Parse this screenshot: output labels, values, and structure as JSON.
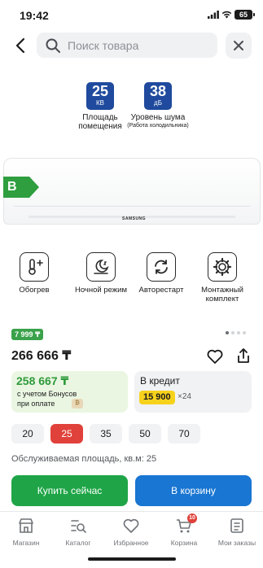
{
  "status_bar": {
    "time": "19:42",
    "battery": "65"
  },
  "search": {
    "placeholder": "Поиск товара"
  },
  "specs": [
    {
      "value": "25",
      "unit": "КВ",
      "label": "Площадь помещения",
      "sub": ""
    },
    {
      "value": "38",
      "unit": "дБ",
      "label": "Уровень шума",
      "sub": "(Работа холодильника)"
    }
  ],
  "product": {
    "brand_logo": "SAMSUNG",
    "energy_class": "B",
    "energy_color": "#2e9e3e"
  },
  "features": [
    {
      "label": "Обогрев",
      "icon": "thermometer-plus-icon"
    },
    {
      "label": "Ночной режим",
      "icon": "night-mode-icon"
    },
    {
      "label": "Авторестарт",
      "icon": "restart-icon"
    },
    {
      "label": "Монтажный комплект",
      "icon": "gear-icon"
    }
  ],
  "pricing": {
    "bonus_tag": "7 999 ₸",
    "price": "266 666 ₸",
    "bonus_price": "258 667 ₸",
    "bonus_line1": "с учетом Бонусов",
    "bonus_line2": "при оплате",
    "credit_title": "В кредит",
    "credit_amount": "15 900",
    "credit_months": "×24"
  },
  "area_options": [
    "20",
    "25",
    "35",
    "50",
    "70"
  ],
  "selected_area": "25",
  "area_label": "Обслуживаемая площадь, кв.м: 25",
  "actions": {
    "buy_now": "Купить сейчас",
    "add_to_cart": "В корзину"
  },
  "tabs": [
    {
      "label": "Магазин",
      "icon": "store-icon"
    },
    {
      "label": "Каталог",
      "icon": "catalog-icon"
    },
    {
      "label": "Избранное",
      "icon": "heart-icon"
    },
    {
      "label": "Корзина",
      "icon": "cart-icon",
      "badge": "10"
    },
    {
      "label": "Мои заказы",
      "icon": "orders-icon"
    }
  ],
  "colors": {
    "accent_red": "#e0413a",
    "buy_green": "#1fa547",
    "cart_blue": "#1976d2",
    "spec_blue": "#1f4a9d",
    "credit_yellow": "#f7d21c"
  }
}
